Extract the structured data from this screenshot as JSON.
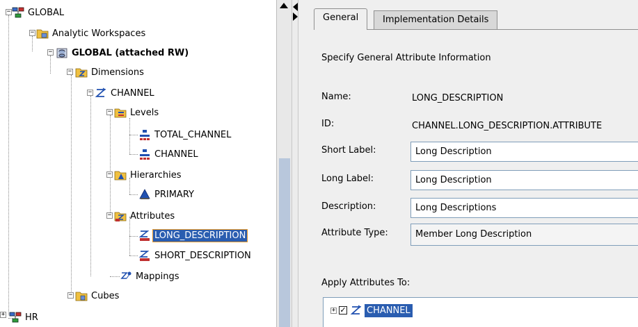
{
  "tree": {
    "nodes": [
      {
        "label": "GLOBAL",
        "icon": "server-icon",
        "expanded": true
      },
      {
        "label": "Analytic Workspaces",
        "icon": "folder-icon",
        "expanded": true
      },
      {
        "label": "GLOBAL (attached RW)",
        "icon": "workspace-icon",
        "expanded": true
      },
      {
        "label": "Dimensions",
        "icon": "dimensions-folder-icon",
        "expanded": true
      },
      {
        "label": "CHANNEL",
        "icon": "dimension-icon",
        "expanded": true
      },
      {
        "label": "Levels",
        "icon": "levels-folder-icon",
        "expanded": true
      },
      {
        "label": "TOTAL_CHANNEL",
        "icon": "level-icon"
      },
      {
        "label": "CHANNEL",
        "icon": "level-icon"
      },
      {
        "label": "Hierarchies",
        "icon": "hierarchies-folder-icon",
        "expanded": true
      },
      {
        "label": "PRIMARY",
        "icon": "hierarchy-icon"
      },
      {
        "label": "Attributes",
        "icon": "attributes-folder-icon",
        "expanded": true
      },
      {
        "label": "LONG_DESCRIPTION",
        "icon": "attribute-icon",
        "selected": true
      },
      {
        "label": "SHORT_DESCRIPTION",
        "icon": "attribute-icon"
      },
      {
        "label": "Mappings",
        "icon": "mappings-icon"
      },
      {
        "label": "Cubes",
        "icon": "folder-icon",
        "expanded": true
      },
      {
        "label": "HR",
        "icon": "server-icon",
        "expanded": false
      }
    ]
  },
  "detail": {
    "tabs": [
      {
        "label": "General",
        "active": true
      },
      {
        "label": "Implementation Details",
        "active": false
      }
    ],
    "heading": "Specify General Attribute Information",
    "name_label": "Name:",
    "name_value": "LONG_DESCRIPTION",
    "id_label": "ID:",
    "id_value": "CHANNEL.LONG_DESCRIPTION.ATTRIBUTE",
    "short_label_label": "Short Label:",
    "short_label_value": "Long Description",
    "long_label_label": "Long Label:",
    "long_label_value": "Long Description",
    "description_label": "Description:",
    "description_value": "Long Descriptions",
    "attribute_type_label": "Attribute Type:",
    "attribute_type_value": "Member Long Description",
    "apply_label": "Apply Attributes To:",
    "apply_items": [
      {
        "label": "CHANNEL",
        "checked": true,
        "expand_symbol": "+"
      }
    ]
  },
  "colors": {
    "selection": "#2a5db0",
    "selection_outline": "#e89a2c",
    "panel_bg": "#efefef",
    "field_border": "#7f9db9"
  }
}
